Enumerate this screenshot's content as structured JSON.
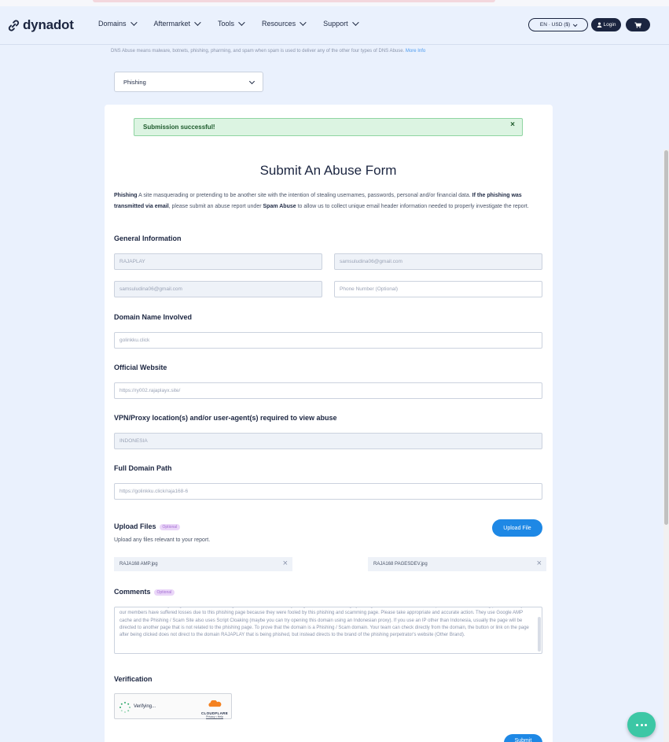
{
  "header": {
    "logo_text": "dynadot",
    "menu": [
      {
        "label": "Domains"
      },
      {
        "label": "Aftermarket"
      },
      {
        "label": "Tools"
      },
      {
        "label": "Resources"
      },
      {
        "label": "Support"
      }
    ],
    "language_currency": "EN · USD ($)",
    "login_label": "Login"
  },
  "notice": {
    "text": "DNS Abuse means malware, botnets, phishing, pharming, and spam when spam is used to deliver any of the other four types of DNS Abuse.",
    "link": "More Info"
  },
  "abuse_type_select": {
    "value": "Phishing"
  },
  "alert": {
    "message": "Submission successful!",
    "close": "×"
  },
  "form": {
    "title": "Submit An Abuse Form",
    "intro": {
      "term": "Phishing",
      "definition": " A site masquerading or pretending to be another site with the intention of stealing usernames, passwords, personal and/or financial data. ",
      "bold_condition": "If the phishing was transmitted via email",
      "mid": ", please submit an abuse report under ",
      "bold_category": "Spam Abuse",
      "end": " to allow us to collect unique email header information needed to properly investigate the report."
    },
    "general_info": {
      "heading": "General Information",
      "name": "RAJAPLAY",
      "email": "samsuludina06@gmail.com",
      "confirm_email": "samsuludina06@gmail.com",
      "phone_placeholder": "Phone Number (Optional)"
    },
    "domain": {
      "heading": "Domain Name Involved",
      "value": "golinkku.click"
    },
    "website": {
      "heading": "Official Website",
      "value": "https://ry002.rajaplayx.site/"
    },
    "vpn": {
      "heading": "VPN/Proxy location(s) and/or user-agent(s) required to view abuse",
      "value": "INDONESIA"
    },
    "path": {
      "heading": "Full Domain Path",
      "value": "https://golinkku.click/raja168-6"
    },
    "upload": {
      "heading": "Upload Files",
      "optional": "Optional",
      "subtitle": "Upload any files relevant to your report.",
      "button": "Upload File",
      "files": [
        {
          "name": "RAJA168 AMP.jpg"
        },
        {
          "name": "RAJA168 PAGESDEV.jpg"
        }
      ]
    },
    "comments": {
      "heading": "Comments",
      "optional": "Optional",
      "text": "This web domain is very dangerous in terms of investigation. Furthermore, this may assign to scam in all through your registrar. We would also like to report this fact to the hosting provider. Many of our members have suffered losses due to this phishing page because they were fooled by this phishing and scamming page. Please take appropriate and accurate action. They use Google AMP cache and the Phishing / Scam Site also uses Script Cloaking (maybe you can try opening this domain using an Indonesian proxy). If you use an IP other than Indonesia, usually the page will be directed to another page that is not related to the phishing page. To prove that the domain is a Phishing / Scam domain. Your team can check directly from the domain, the button or link on the page after being clicked does not direct to the domain RAJAPLAY that is being phished, but instead directs to the brand of the phishing perpetrator's website (Other Brand)."
    },
    "verification": {
      "heading": "Verification",
      "status": "Verifying...",
      "brand": "CLOUDFLARE",
      "privacy": "Privacy",
      "terms": "Help"
    },
    "submit_label": "Submit"
  }
}
